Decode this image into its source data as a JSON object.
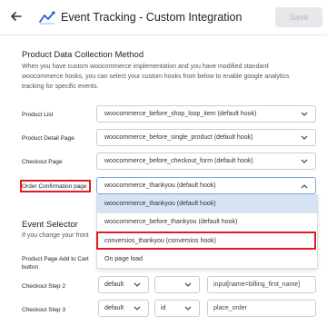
{
  "header": {
    "title": "Event Tracking - Custom Integration",
    "save_label": "Save"
  },
  "section": {
    "title": "Product Data Collection Method",
    "description": "When you have custom woocommerce implementation and you have modified standard woocommerce hooks, you can select your custom hooks from below to enable google analytics tracking for specific events."
  },
  "rows": [
    {
      "label": "Product List",
      "value": "woocommerce_before_shop_loop_item (default hook)"
    },
    {
      "label": "Product Detail Page",
      "value": "woocommerce_before_single_product (default hook)"
    },
    {
      "label": "Checkout Page",
      "value": "woocommerce_before_checkout_form (default hook)"
    },
    {
      "label": "Order Confirmation page",
      "value": "woocommerce_thankyou (default hook)"
    }
  ],
  "dropdown_options": [
    "woocommerce_thankyou (default hook)",
    "woocommerce_before_thankyou (default hook)",
    "conversios_thankyou (conversios hook)",
    "On page load"
  ],
  "event_selector": {
    "title": "Event Selector",
    "description": "If you change your front",
    "rows": [
      {
        "label": "Product Page Add to Cart button",
        "select1": "",
        "select2": "",
        "input": ""
      },
      {
        "label": "Checkout Step 2",
        "select1": "default",
        "select2": "",
        "input": "input[name=billing_first_name]"
      },
      {
        "label": "Checkout Step 3",
        "select1": "default",
        "select2": "id",
        "input": "place_order"
      }
    ]
  },
  "colors": {
    "highlight": "#e11b22",
    "selected_option_bg": "#d5e3f3",
    "save_button_bg": "#e6e8ec"
  }
}
